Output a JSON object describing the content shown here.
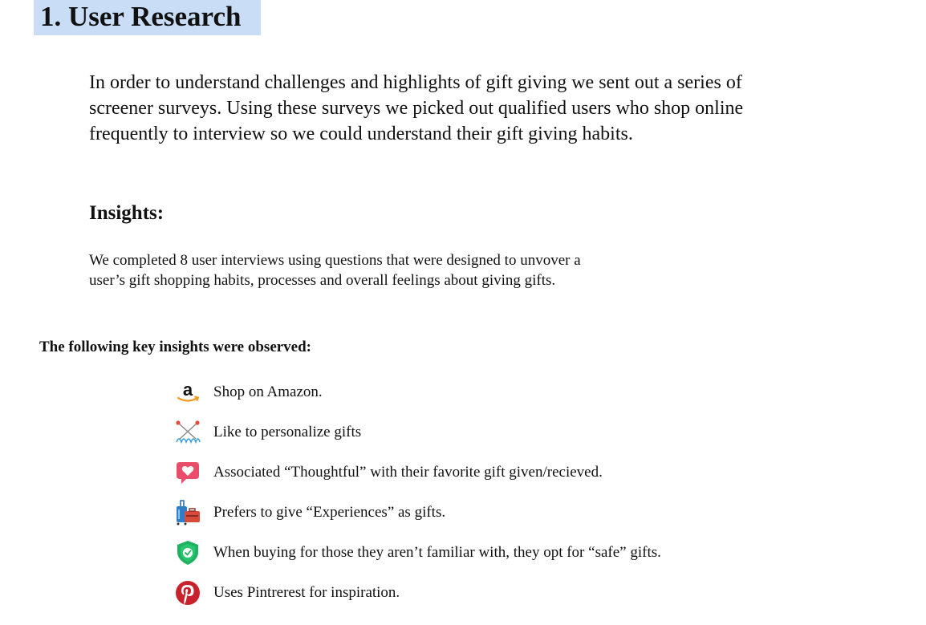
{
  "section": {
    "title": "1. User Research",
    "intro": "In order to understand challenges and highlights of gift giving we sent out a series of screener surveys. Using these surveys we picked out qualified users who shop online frequently to interview so we could understand their gift giving habits.",
    "insights_heading": "Insights:",
    "interviews_text": "We completed 8 user interviews using questions that were designed to unvover a user’s gift shopping habits, processes and overall feelings about giving gifts.",
    "key_heading": "The following key insights were observed:",
    "highlight_color": "#c9ddf6"
  },
  "insights": [
    {
      "icon": "amazon-logo-icon",
      "text": "Shop on Amazon."
    },
    {
      "icon": "personalize-pins-icon",
      "text": "Like to personalize gifts"
    },
    {
      "icon": "heart-speech-bubble-icon",
      "text": "Associated “Thoughtful” with their favorite gift given/recieved."
    },
    {
      "icon": "luggage-icon",
      "text": "Prefers to give “Experiences” as gifts."
    },
    {
      "icon": "green-shield-icon",
      "text": "When buying for those they aren’t familiar with, they opt for “safe” gifts."
    },
    {
      "icon": "pinterest-logo-icon",
      "text": "Uses Pintrerest for inspiration."
    }
  ]
}
